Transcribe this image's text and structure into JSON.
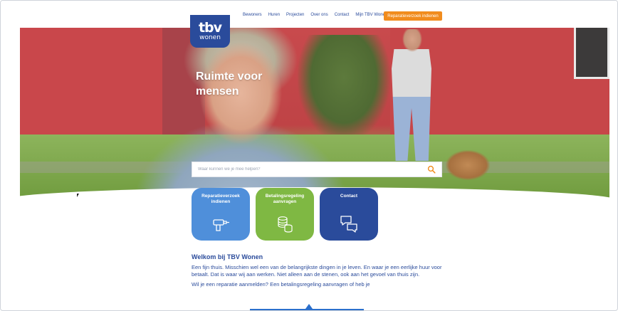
{
  "header": {
    "logo_big": "tbv",
    "logo_small": "wonen",
    "nav": [
      "Bewoners",
      "Huren",
      "Projecten",
      "Over ons",
      "Contact",
      "Mijn TBV Wonen"
    ],
    "cta_label": "Reparatieverzoek indienen"
  },
  "hero": {
    "title": "Ruimte voor mensen",
    "search_placeholder": "Waar kunnen we je mee helpen?"
  },
  "tiles": [
    {
      "label": "Reparatieverzoek indienen",
      "icon": "drill-icon",
      "color": "#4f8fda"
    },
    {
      "label": "Betalingsregeling aanvragen",
      "icon": "coins-icon",
      "color": "#7fb843"
    },
    {
      "label": "Contact",
      "icon": "chat-bubbles-icon",
      "color": "#2a4b9b"
    }
  ],
  "welcome": {
    "title": "Welkom bij TBV Wonen",
    "paragraph1": "Een fijn thuis. Misschien wel een van de belangrijkste dingen in je leven. En waar je een eerlijke huur voor betaalt. Dat is waar wij aan werken. Niet alleen aan de stenen, ook aan het gevoel van thuis zijn.",
    "paragraph2": "Wil je een reparatie aanmelden? Een betalingsregeling aanvragen of heb je"
  },
  "colors": {
    "brand_navy": "#2a4b9b",
    "accent_orange": "#f18c1e",
    "tile_blue": "#4f8fda",
    "tile_green": "#7fb843"
  }
}
